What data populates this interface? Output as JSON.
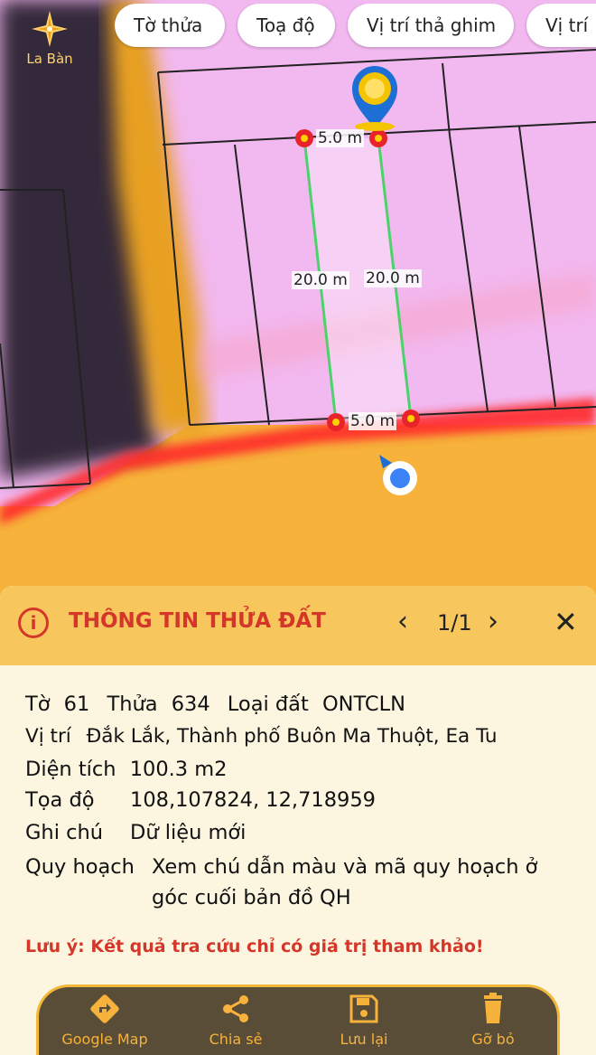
{
  "compass": {
    "label": "La Bàn",
    "icon": "compass-icon"
  },
  "tabs": [
    "Tờ thửa",
    "Toạ độ",
    "Vị trí thả ghim",
    "Vị trí"
  ],
  "map": {
    "measurements": {
      "top": "5.0 m",
      "left": "20.0 m",
      "right": "20.0 m",
      "bottom": "5.0 m"
    },
    "parcel_line_color": "#4cd26b",
    "highlight_color": "#ff2a2a",
    "background_color": "#f6b23a",
    "pink_color": "#f2b8f0"
  },
  "sheet": {
    "title": "THÔNG TIN THỬA ĐẤT",
    "pager": "1/1",
    "fields": {
      "to_label": "Tờ",
      "to_value": "61",
      "thua_label": "Thửa",
      "thua_value": "634",
      "loai_label": "Loại đất",
      "loai_value": "ONTCLN",
      "vitri_label": "Vị trí",
      "vitri_value": "Đắk Lắk, Thành phố Buôn Ma Thuột, Ea Tu",
      "dientich_label": "Diện tích",
      "dientich_value": "100.3 m2",
      "toado_label": "Tọa độ",
      "toado_value": "108,107824, 12,718959",
      "ghichu_label": "Ghi chú",
      "ghichu_value": "Dữ liệu mới",
      "quyhoach_label": "Quy hoạch",
      "quyhoach_value_1": "Xem chú dẫn màu và mã quy hoạch ở",
      "quyhoach_value_2": "góc cuối bản đồ QH"
    },
    "note": "Lưu ý: Kết quả tra cứu chỉ có giá trị tham khảo!"
  },
  "toolbar": {
    "items": [
      {
        "label": "Google Map",
        "icon": "directions-icon"
      },
      {
        "label": "Chia sẻ",
        "icon": "share-icon"
      },
      {
        "label": "Lưu lại",
        "icon": "save-icon"
      },
      {
        "label": "Gỡ bỏ",
        "icon": "trash-icon"
      }
    ]
  }
}
